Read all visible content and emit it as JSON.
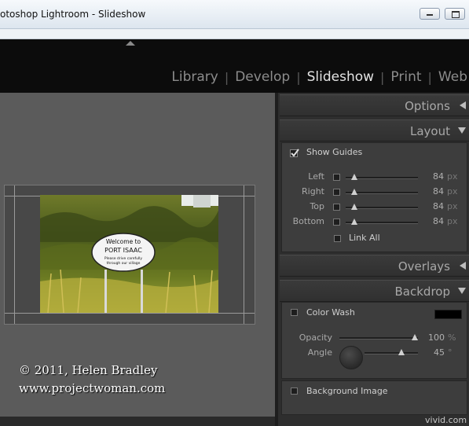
{
  "window": {
    "title": "otoshop Lightroom - Slideshow",
    "minimize_icon": "minimize-icon",
    "maximize_icon": "maximize-icon"
  },
  "modules": [
    {
      "label": "Library",
      "active": false
    },
    {
      "label": "Develop",
      "active": false
    },
    {
      "label": "Slideshow",
      "active": true
    },
    {
      "label": "Print",
      "active": false
    },
    {
      "label": "Web",
      "active": false
    }
  ],
  "module_separator": "|",
  "panels": {
    "options": {
      "label": "Options",
      "icon": "triangle-down-icon"
    },
    "layout": {
      "label": "Layout",
      "icon": "triangle-down-icon",
      "show_guides_label": "Show Guides",
      "show_guides_checked": true,
      "rows": [
        {
          "label": "Left",
          "value": "84",
          "unit": "px",
          "fraction": 0.12
        },
        {
          "label": "Right",
          "value": "84",
          "unit": "px",
          "fraction": 0.12
        },
        {
          "label": "Top",
          "value": "84",
          "unit": "px",
          "fraction": 0.12
        },
        {
          "label": "Bottom",
          "value": "84",
          "unit": "px",
          "fraction": 0.12
        }
      ],
      "link_all_label": "Link All"
    },
    "overlays": {
      "label": "Overlays",
      "icon": "triangle-left-icon"
    },
    "backdrop": {
      "label": "Backdrop",
      "icon": "triangle-down-icon",
      "color_wash_label": "Color Wash",
      "color_wash_color": "#000000",
      "opacity_label": "Opacity",
      "opacity_value": "100",
      "opacity_unit": "%",
      "opacity_fraction": 1.0,
      "angle_label": "Angle",
      "angle_value": "45",
      "angle_unit": "°",
      "angle_fraction": 0.75,
      "background_image_label": "Background Image"
    }
  },
  "slide": {
    "sign_line1": "Welcome to",
    "sign_line2": "PORT ISAAC",
    "sign_line3": "Please drive carefully",
    "sign_line4": "through our village"
  },
  "credit": {
    "line1": "© 2011, Helen Bradley",
    "line2": "www.projectwoman.com"
  },
  "watermark": "vivid.com",
  "colors": {
    "module_active": "#e3e3e3",
    "module_inactive": "#8c8c8c",
    "panel_bg": "#3d3d3d"
  }
}
